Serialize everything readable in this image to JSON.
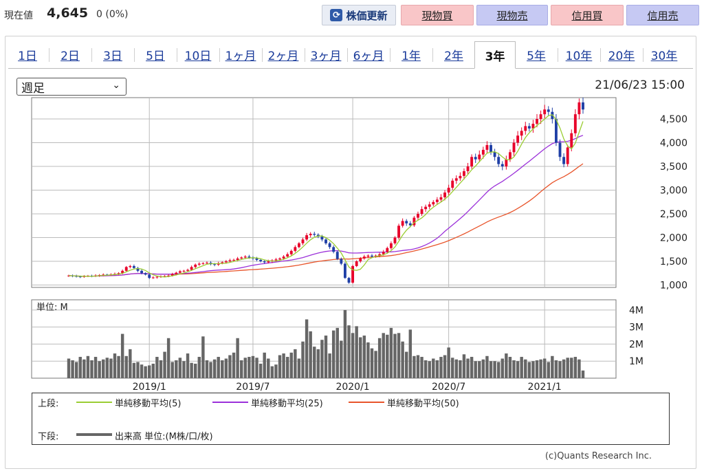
{
  "header": {
    "price_label": "現在値",
    "price_value": "4,645",
    "change": "0 (0%)",
    "refresh_label": "株価更新",
    "buttons": [
      "現物買",
      "現物売",
      "信用買",
      "信用売"
    ]
  },
  "tabs": [
    "1日",
    "2日",
    "3日",
    "5日",
    "10日",
    "1ヶ月",
    "2ヶ月",
    "3ヶ月",
    "6ヶ月",
    "1年",
    "2年",
    "3年",
    "5年",
    "10年",
    "20年",
    "30年"
  ],
  "active_tab": "3年",
  "period_select": "週足",
  "datetime": "21/06/23 15:00",
  "volume_unit_label": "単位: M",
  "legend": {
    "upper_label": "上段:",
    "lower_label": "下段:",
    "ma5": "単純移動平均(5)",
    "ma25": "単純移動平均(25)",
    "ma50": "単純移動平均(50)",
    "volume": "出来高 単位:(M株/口/枚)"
  },
  "copyright": "(c)Quants Research Inc.",
  "colors": {
    "up": "#e8002a",
    "down": "#1f3fa6",
    "ma5": "#9acd32",
    "ma25": "#9b30d9",
    "ma50": "#e8542a",
    "volume": "#666666"
  },
  "chart_data": {
    "type": "candlestick",
    "price_axis": {
      "ticks": [
        1000,
        1500,
        2000,
        2500,
        3000,
        3500,
        4000,
        4500
      ],
      "tick_labels": [
        "1,000",
        "1,500",
        "2,000",
        "2,500",
        "3,000",
        "3,500",
        "4,000",
        "4,500"
      ],
      "range": [
        950,
        4950
      ]
    },
    "volume_axis": {
      "ticks": [
        1,
        2,
        3,
        4
      ],
      "tick_labels": [
        "1M",
        "2M",
        "3M",
        "4M"
      ],
      "range": [
        0,
        4.6
      ]
    },
    "x_ticks": [
      "2019/1",
      "2019/7",
      "2020/1",
      "2020/7",
      "2021/1"
    ],
    "x_tick_index": [
      21,
      48,
      74,
      99,
      124
    ],
    "close": [
      1200,
      1190,
      1180,
      1175,
      1185,
      1195,
      1190,
      1200,
      1210,
      1220,
      1215,
      1225,
      1235,
      1250,
      1300,
      1380,
      1400,
      1360,
      1300,
      1250,
      1220,
      1150,
      1160,
      1175,
      1180,
      1190,
      1200,
      1230,
      1260,
      1290,
      1300,
      1320,
      1380,
      1430,
      1450,
      1460,
      1470,
      1440,
      1430,
      1460,
      1480,
      1500,
      1520,
      1530,
      1560,
      1580,
      1600,
      1580,
      1560,
      1530,
      1500,
      1480,
      1500,
      1520,
      1540,
      1560,
      1600,
      1650,
      1720,
      1800,
      1880,
      1960,
      2050,
      2080,
      2060,
      2020,
      1960,
      1880,
      1800,
      1700,
      1550,
      1450,
      1150,
      1050,
      1400,
      1500,
      1560,
      1600,
      1620,
      1600,
      1620,
      1650,
      1700,
      1780,
      1880,
      2000,
      2250,
      2350,
      2300,
      2260,
      2420,
      2500,
      2600,
      2650,
      2700,
      2750,
      2800,
      2850,
      2950,
      3050,
      3200,
      3250,
      3300,
      3400,
      3500,
      3700,
      3650,
      3750,
      3850,
      3950,
      3800,
      3700,
      3550,
      3500,
      3650,
      3800,
      4000,
      4150,
      4250,
      4350,
      4300,
      4400,
      4500,
      4600,
      4700,
      4650,
      4500,
      4000,
      3700,
      3550,
      3900,
      4200,
      4600,
      4850,
      4700
    ],
    "volume": [
      1.15,
      1.05,
      0.95,
      1.25,
      1.1,
      1.3,
      1.05,
      1.25,
      1.0,
      1.1,
      1.2,
      1.15,
      1.45,
      1.3,
      2.6,
      1.3,
      1.7,
      0.9,
      0.95,
      0.8,
      0.7,
      0.75,
      0.85,
      1.25,
      1.05,
      1.55,
      2.35,
      0.95,
      1.05,
      1.2,
      1.0,
      1.45,
      0.9,
      0.85,
      1.25,
      2.45,
      1.05,
      0.95,
      1.1,
      1.25,
      1.05,
      1.15,
      1.35,
      1.5,
      2.35,
      1.05,
      1.2,
      1.25,
      1.3,
      1.2,
      0.85,
      1.5,
      1.15,
      0.7,
      0.8,
      1.35,
      1.45,
      1.25,
      1.5,
      1.7,
      1.15,
      2.15,
      3.45,
      2.75,
      1.85,
      1.7,
      2.25,
      2.5,
      1.45,
      2.8,
      2.95,
      2.2,
      4.0,
      3.1,
      2.65,
      3.05,
      2.4,
      2.5,
      2.1,
      1.75,
      1.6,
      2.35,
      2.65,
      2.55,
      2.95,
      2.6,
      2.65,
      2.15,
      1.55,
      2.85,
      1.3,
      1.35,
      1.25,
      1.05,
      1.0,
      1.15,
      1.05,
      1.25,
      1.35,
      1.8,
      1.2,
      1.1,
      1.05,
      1.4,
      1.15,
      1.25,
      1.0,
      1.0,
      1.1,
      1.3,
      1.0,
      1.0,
      0.95,
      1.15,
      1.45,
      1.25,
      1.05,
      1.0,
      1.25,
      1.1,
      0.95,
      1.0,
      1.05,
      1.1,
      1.15,
      0.95,
      1.3,
      1.05,
      1.0,
      1.1,
      1.2,
      1.2,
      1.25,
      1.1,
      0.45
    ]
  }
}
